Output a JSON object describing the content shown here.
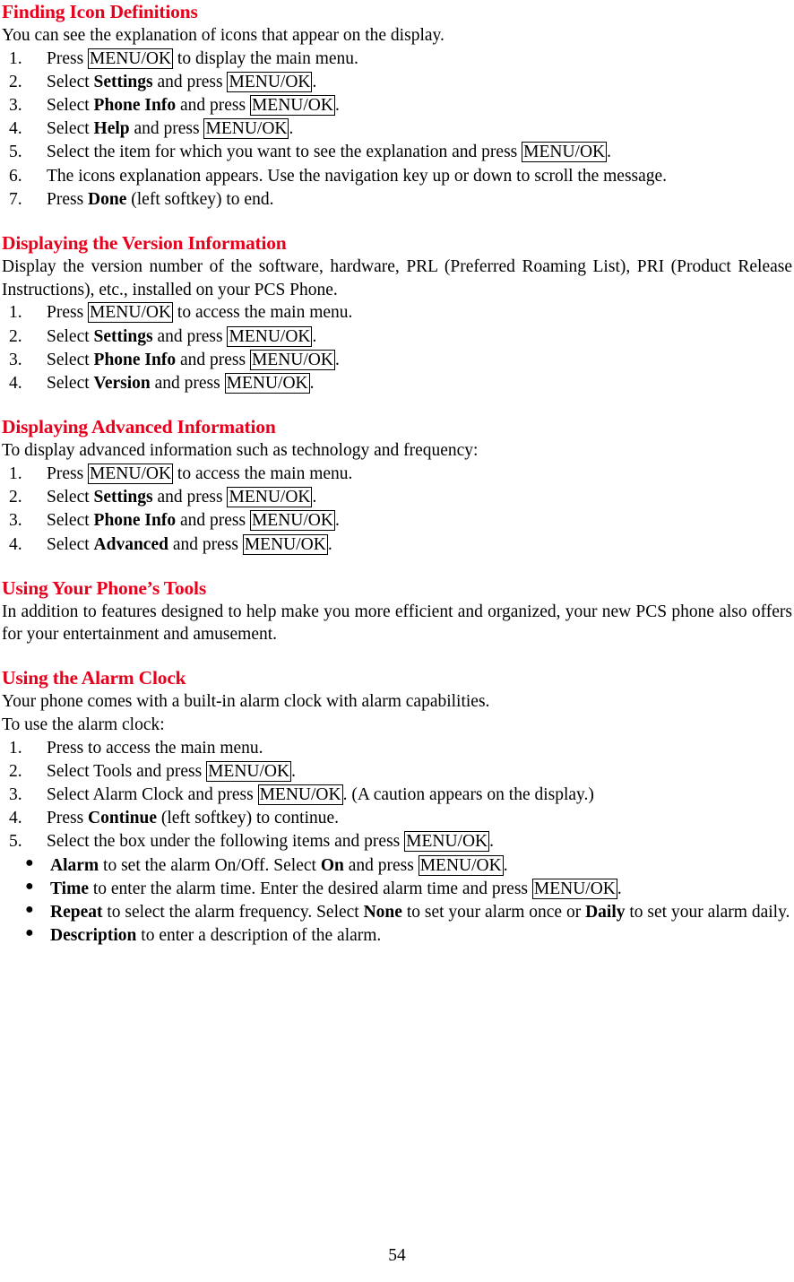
{
  "page": {
    "number": "54"
  },
  "sections": [
    {
      "id": "finding-icon-definitions",
      "title": "Finding Icon Definitions",
      "intro": "You can see the explanation of icons that appear on the display.",
      "steps": [
        {
          "num": "1.",
          "parts": [
            {
              "t": "Press ",
              "s": "plain"
            },
            {
              "t": "MENU/OK",
              "s": "key"
            },
            {
              "t": " to display the main menu.",
              "s": "plain"
            }
          ]
        },
        {
          "num": "2.",
          "parts": [
            {
              "t": "Select ",
              "s": "plain"
            },
            {
              "t": "Settings",
              "s": "bold"
            },
            {
              "t": " and press ",
              "s": "plain"
            },
            {
              "t": "MENU/OK",
              "s": "key"
            },
            {
              "t": ".",
              "s": "plain"
            }
          ]
        },
        {
          "num": "3.",
          "parts": [
            {
              "t": "Select ",
              "s": "plain"
            },
            {
              "t": "Phone Info",
              "s": "bold"
            },
            {
              "t": " and press ",
              "s": "plain"
            },
            {
              "t": "MENU/OK",
              "s": "key"
            },
            {
              "t": ".",
              "s": "plain"
            }
          ]
        },
        {
          "num": "4.",
          "parts": [
            {
              "t": "Select ",
              "s": "plain"
            },
            {
              "t": "Help",
              "s": "bold"
            },
            {
              "t": " and press ",
              "s": "plain"
            },
            {
              "t": "MENU/OK",
              "s": "key"
            },
            {
              "t": ".",
              "s": "plain"
            }
          ]
        },
        {
          "num": "5.",
          "parts": [
            {
              "t": "Select the item for which you want to see the explanation and press ",
              "s": "plain"
            },
            {
              "t": "MENU/OK",
              "s": "key"
            },
            {
              "t": ".",
              "s": "plain"
            }
          ]
        },
        {
          "num": "6.",
          "parts": [
            {
              "t": "The icons explanation appears. Use the navigation key up or down to scroll the message.",
              "s": "plain"
            }
          ]
        },
        {
          "num": "7.",
          "parts": [
            {
              "t": "Press ",
              "s": "plain"
            },
            {
              "t": "Done",
              "s": "bold"
            },
            {
              "t": " (left softkey) to end.",
              "s": "plain"
            }
          ]
        }
      ]
    },
    {
      "id": "displaying-version-information",
      "title": "Displaying the Version Information",
      "intro": "Display the version number of the software, hardware, PRL (Preferred Roaming List), PRI (Product Release Instructions), etc., installed on your PCS Phone.",
      "steps": [
        {
          "num": "1.",
          "parts": [
            {
              "t": "Press ",
              "s": "plain"
            },
            {
              "t": "MENU/OK",
              "s": "key"
            },
            {
              "t": " to access the main menu.",
              "s": "plain"
            }
          ]
        },
        {
          "num": "2.",
          "parts": [
            {
              "t": "Select ",
              "s": "plain"
            },
            {
              "t": "Settings",
              "s": "bold"
            },
            {
              "t": " and press ",
              "s": "plain"
            },
            {
              "t": "MENU/OK",
              "s": "key"
            },
            {
              "t": ".",
              "s": "plain"
            }
          ]
        },
        {
          "num": "3.",
          "parts": [
            {
              "t": "Select ",
              "s": "plain"
            },
            {
              "t": "Phone Info",
              "s": "bold"
            },
            {
              "t": " and press ",
              "s": "plain"
            },
            {
              "t": "MENU/OK",
              "s": "key"
            },
            {
              "t": ".",
              "s": "plain"
            }
          ]
        },
        {
          "num": "4.",
          "parts": [
            {
              "t": "Select ",
              "s": "plain"
            },
            {
              "t": "Version",
              "s": "bold"
            },
            {
              "t": " and press ",
              "s": "plain"
            },
            {
              "t": "MENU/OK",
              "s": "key"
            },
            {
              "t": ".",
              "s": "plain"
            }
          ]
        }
      ]
    },
    {
      "id": "displaying-advanced-information",
      "title": "Displaying Advanced Information",
      "intro": "To display advanced information such as technology and frequency:",
      "steps": [
        {
          "num": "1.",
          "parts": [
            {
              "t": "Press ",
              "s": "plain"
            },
            {
              "t": "MENU/OK",
              "s": "key"
            },
            {
              "t": " to access the main menu.",
              "s": "plain"
            }
          ]
        },
        {
          "num": "2.",
          "parts": [
            {
              "t": "Select ",
              "s": "plain"
            },
            {
              "t": "Settings",
              "s": "bold"
            },
            {
              "t": " and press ",
              "s": "plain"
            },
            {
              "t": "MENU/OK",
              "s": "key"
            },
            {
              "t": ".",
              "s": "plain"
            }
          ]
        },
        {
          "num": "3.",
          "parts": [
            {
              "t": "Select ",
              "s": "plain"
            },
            {
              "t": "Phone Info",
              "s": "bold"
            },
            {
              "t": " and press ",
              "s": "plain"
            },
            {
              "t": "MENU/OK",
              "s": "key"
            },
            {
              "t": ".",
              "s": "plain"
            }
          ]
        },
        {
          "num": "4.",
          "parts": [
            {
              "t": "Select ",
              "s": "plain"
            },
            {
              "t": "Advanced",
              "s": "bold"
            },
            {
              "t": " and press ",
              "s": "plain"
            },
            {
              "t": "MENU/OK",
              "s": "key"
            },
            {
              "t": ".",
              "s": "plain"
            }
          ]
        }
      ]
    },
    {
      "id": "using-your-phones-tools",
      "title": "Using Your Phone’s Tools",
      "intro": "In addition to features designed to help make you more efficient and organized, your new PCS phone also offers for your entertainment and amusement.",
      "steps": []
    },
    {
      "id": "using-the-alarm-clock",
      "title": "Using the Alarm Clock",
      "intro": "Your phone comes with a built-in alarm clock with alarm capabilities.",
      "intro2": "To use the alarm clock:",
      "steps": [
        {
          "num": "1.",
          "parts": [
            {
              "t": "Press to access the main menu.",
              "s": "plain"
            }
          ]
        },
        {
          "num": "2.",
          "parts": [
            {
              "t": "Select Tools and press ",
              "s": "plain"
            },
            {
              "t": "MENU/OK",
              "s": "key"
            },
            {
              "t": ".",
              "s": "plain"
            }
          ]
        },
        {
          "num": "3.",
          "parts": [
            {
              "t": "Select Alarm Clock and press ",
              "s": "plain"
            },
            {
              "t": "MENU/OK",
              "s": "key"
            },
            {
              "t": ". (A caution appears on the display.)",
              "s": "plain"
            }
          ]
        },
        {
          "num": "4.",
          "parts": [
            {
              "t": "Press ",
              "s": "plain"
            },
            {
              "t": "Continue",
              "s": "bold"
            },
            {
              "t": " (left softkey) to continue.",
              "s": "plain"
            }
          ]
        },
        {
          "num": "5.",
          "parts": [
            {
              "t": "Select the box under the following items and press ",
              "s": "plain"
            },
            {
              "t": "MENU/OK",
              "s": "key"
            },
            {
              "t": ".",
              "s": "plain"
            }
          ]
        }
      ],
      "bullets": [
        {
          "parts": [
            {
              "t": "Alarm",
              "s": "bold"
            },
            {
              "t": " to set the alarm On/Off. Select ",
              "s": "plain"
            },
            {
              "t": "On",
              "s": "bold"
            },
            {
              "t": " and press ",
              "s": "plain"
            },
            {
              "t": "MENU/OK",
              "s": "key"
            },
            {
              "t": ".",
              "s": "plain"
            }
          ]
        },
        {
          "parts": [
            {
              "t": "Time",
              "s": "bold"
            },
            {
              "t": " to enter the alarm time. Enter the desired alarm time and press ",
              "s": "plain"
            },
            {
              "t": "MENU/OK",
              "s": "key"
            },
            {
              "t": ".",
              "s": "plain"
            }
          ]
        },
        {
          "parts": [
            {
              "t": "Repeat",
              "s": "bold"
            },
            {
              "t": " to select the alarm frequency. Select ",
              "s": "plain"
            },
            {
              "t": "None",
              "s": "bold"
            },
            {
              "t": " to set your alarm once or ",
              "s": "plain"
            },
            {
              "t": "Daily",
              "s": "bold"
            },
            {
              "t": " to set your alarm daily.",
              "s": "plain"
            }
          ]
        },
        {
          "parts": [
            {
              "t": "Description",
              "s": "bold"
            },
            {
              "t": " to enter a description of the alarm.",
              "s": "plain"
            }
          ]
        }
      ]
    }
  ]
}
